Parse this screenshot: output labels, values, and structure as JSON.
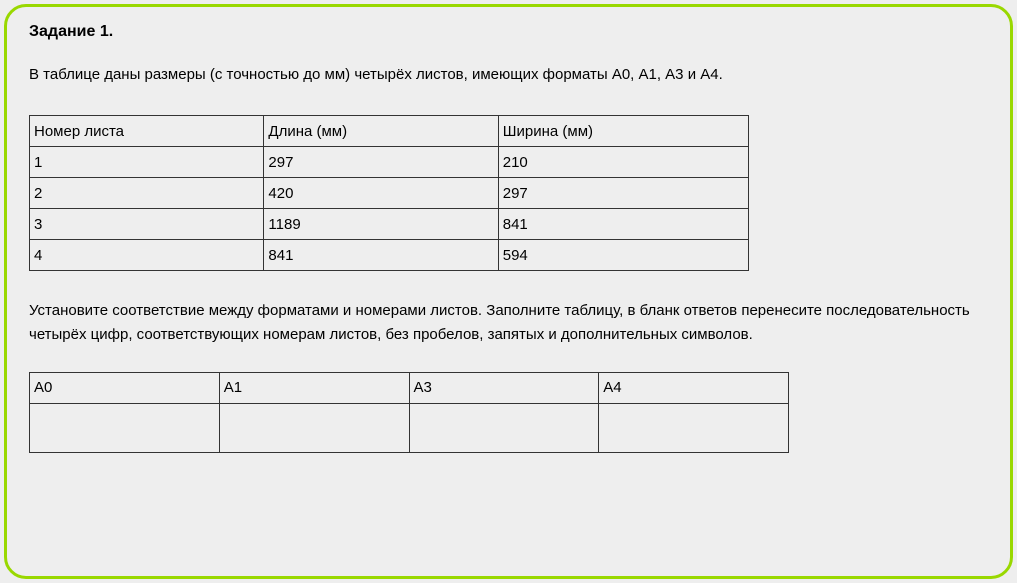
{
  "title": "Задание 1.",
  "intro": "В таблице даны размеры (с точностью до мм) четырёх листов, имеющих форматы А0, А1, А3 и А4.",
  "table1": {
    "headers": [
      "Номер листа",
      "Длина (мм)",
      "Ширина (мм)"
    ],
    "rows": [
      [
        "1",
        "297",
        "210"
      ],
      [
        "2",
        "420",
        "297"
      ],
      [
        "3",
        "1189",
        "841"
      ],
      [
        "4",
        "841",
        "594"
      ]
    ]
  },
  "instructions": "Установите соответствие между форматами и номерами листов. Заполните таблицу, в бланк ответов перенесите последовательность четырёх цифр, соответствующих номерам листов, без пробелов, запятых и дополнительных символов.",
  "table2": {
    "headers": [
      "А0",
      "А1",
      "А3",
      "А4"
    ],
    "cells": [
      "",
      "",
      "",
      ""
    ]
  },
  "chart_data": {
    "type": "table",
    "title": "Размеры листов",
    "columns": [
      "Номер листа",
      "Длина (мм)",
      "Ширина (мм)"
    ],
    "rows": [
      {
        "Номер листа": 1,
        "Длина (мм)": 297,
        "Ширина (мм)": 210
      },
      {
        "Номер листа": 2,
        "Длина (мм)": 420,
        "Ширина (мм)": 297
      },
      {
        "Номер листа": 3,
        "Длина (мм)": 1189,
        "Ширина (мм)": 841
      },
      {
        "Номер листа": 4,
        "Длина (мм)": 841,
        "Ширина (мм)": 594
      }
    ]
  }
}
